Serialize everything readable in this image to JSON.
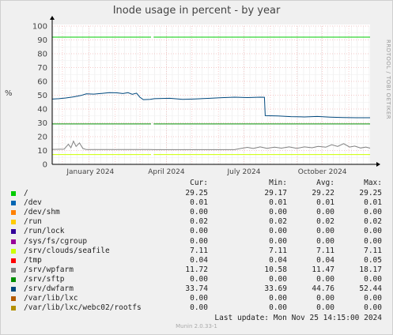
{
  "title": "Inode usage in percent - by year",
  "side_label": "RRDTOOL / TOBI OETIKER",
  "y_axis_label": "%",
  "columns": [
    "Cur:",
    "Min:",
    "Avg:",
    "Max:"
  ],
  "legend": [
    {
      "name": "/",
      "color": "#00cc00",
      "cur": "29.25",
      "min": "29.17",
      "avg": "29.22",
      "max": "29.25"
    },
    {
      "name": "/dev",
      "color": "#0066b3",
      "cur": "0.01",
      "min": "0.01",
      "avg": "0.01",
      "max": "0.01"
    },
    {
      "name": "/dev/shm",
      "color": "#ff8000",
      "cur": "0.00",
      "min": "0.00",
      "avg": "0.00",
      "max": "0.00"
    },
    {
      "name": "/run",
      "color": "#ffcc00",
      "cur": "0.02",
      "min": "0.02",
      "avg": "0.02",
      "max": "0.02"
    },
    {
      "name": "/run/lock",
      "color": "#330099",
      "cur": "0.00",
      "min": "0.00",
      "avg": "0.00",
      "max": "0.00"
    },
    {
      "name": "/sys/fs/cgroup",
      "color": "#990099",
      "cur": "0.00",
      "min": "0.00",
      "avg": "0.00",
      "max": "0.00"
    },
    {
      "name": "/srv/clouds/seafile",
      "color": "#ccff00",
      "cur": "7.11",
      "min": "7.11",
      "avg": "7.11",
      "max": "7.11"
    },
    {
      "name": "/tmp",
      "color": "#ff0000",
      "cur": "0.04",
      "min": "0.04",
      "avg": "0.04",
      "max": "0.05"
    },
    {
      "name": "/srv/wpfarm",
      "color": "#808080",
      "cur": "11.72",
      "min": "10.58",
      "avg": "11.47",
      "max": "18.17"
    },
    {
      "name": "/srv/sftp",
      "color": "#008f00",
      "cur": "0.00",
      "min": "0.00",
      "avg": "0.00",
      "max": "0.00"
    },
    {
      "name": "/srv/dwfarm",
      "color": "#00487d",
      "cur": "33.74",
      "min": "33.69",
      "avg": "44.76",
      "max": "52.44"
    },
    {
      "name": "/var/lib/lxc",
      "color": "#b35a00",
      "cur": "0.00",
      "min": "0.00",
      "avg": "0.00",
      "max": "0.00"
    },
    {
      "name": "/var/lib/lxc/webc02/rootfs",
      "color": "#b38f00",
      "cur": "0.00",
      "min": "0.00",
      "avg": "0.00",
      "max": "0.00"
    }
  ],
  "last_update": "Last update:  Mon Nov 25 14:15:00 2024",
  "munin_version": "Munin 2.0.33-1",
  "chart_data": {
    "type": "line",
    "ylim": [
      0,
      100
    ],
    "y_ticks": [
      "0",
      "10",
      "20",
      "30",
      "40",
      "50",
      "60",
      "70",
      "80",
      "90",
      "100"
    ],
    "x_range": [
      "2023-11-19",
      "2024-11-26"
    ],
    "x_ticks": [
      {
        "label": "January 2024",
        "date": "2024-01-01"
      },
      {
        "label": "April 2024",
        "date": "2024-04-01"
      },
      {
        "label": "July 2024",
        "date": "2024-07-01"
      },
      {
        "label": "October 2024",
        "date": "2024-10-01"
      }
    ],
    "gap": [
      "2024-03-14",
      "2024-03-17"
    ],
    "series": [
      {
        "name": "/",
        "color": "#00cc00",
        "points": [
          [
            "2023-11-19",
            92.0
          ],
          [
            "2024-11-26",
            92.0
          ]
        ]
      },
      {
        "name": "/srv/clouds/seafile",
        "color": "#ccff00",
        "points": [
          [
            "2023-11-19",
            7.11
          ],
          [
            "2024-11-26",
            7.11
          ]
        ]
      },
      {
        "name": "/srv/sftp",
        "color": "#008f00",
        "points": [
          [
            "2023-11-19",
            29.2
          ],
          [
            "2024-11-26",
            29.2
          ]
        ]
      },
      {
        "name": "/srv/wpfarm",
        "color": "#808080",
        "points": [
          [
            "2023-11-19",
            10.8
          ],
          [
            "2023-12-03",
            11.0
          ],
          [
            "2023-12-08",
            14.5
          ],
          [
            "2023-12-11",
            12.0
          ],
          [
            "2023-12-14",
            16.8
          ],
          [
            "2023-12-17",
            13.0
          ],
          [
            "2023-12-21",
            15.5
          ],
          [
            "2023-12-25",
            11.5
          ],
          [
            "2023-12-29",
            10.7
          ],
          [
            "2024-02-10",
            10.7
          ],
          [
            "2024-03-13",
            10.7
          ],
          [
            "2024-03-18",
            10.6
          ],
          [
            "2024-05-15",
            10.6
          ],
          [
            "2024-06-20",
            10.6
          ],
          [
            "2024-06-28",
            11.6
          ],
          [
            "2024-07-05",
            12.3
          ],
          [
            "2024-07-12",
            11.5
          ],
          [
            "2024-07-20",
            12.6
          ],
          [
            "2024-07-28",
            11.6
          ],
          [
            "2024-08-06",
            12.4
          ],
          [
            "2024-08-14",
            11.7
          ],
          [
            "2024-08-23",
            12.6
          ],
          [
            "2024-09-01",
            11.6
          ],
          [
            "2024-09-10",
            12.6
          ],
          [
            "2024-09-19",
            12.0
          ],
          [
            "2024-09-26",
            13.0
          ],
          [
            "2024-10-05",
            12.4
          ],
          [
            "2024-10-12",
            14.2
          ],
          [
            "2024-10-19",
            13.0
          ],
          [
            "2024-10-26",
            15.0
          ],
          [
            "2024-11-02",
            12.5
          ],
          [
            "2024-11-08",
            13.2
          ],
          [
            "2024-11-15",
            11.8
          ],
          [
            "2024-11-21",
            12.5
          ],
          [
            "2024-11-26",
            11.7
          ]
        ]
      },
      {
        "name": "/srv/dwfarm",
        "color": "#00487d",
        "points": [
          [
            "2023-11-19",
            47.2
          ],
          [
            "2023-11-27",
            47.5
          ],
          [
            "2023-12-05",
            48.0
          ],
          [
            "2023-12-14",
            48.8
          ],
          [
            "2023-12-23",
            49.8
          ],
          [
            "2023-12-29",
            51.0
          ],
          [
            "2024-01-07",
            50.8
          ],
          [
            "2024-01-16",
            51.3
          ],
          [
            "2024-01-25",
            51.8
          ],
          [
            "2024-02-03",
            51.7
          ],
          [
            "2024-02-10",
            51.2
          ],
          [
            "2024-02-16",
            51.8
          ],
          [
            "2024-02-21",
            50.7
          ],
          [
            "2024-02-26",
            51.5
          ],
          [
            "2024-03-01",
            48.5
          ],
          [
            "2024-03-05",
            46.8
          ],
          [
            "2024-03-13",
            47.0
          ],
          [
            "2024-03-18",
            47.5
          ],
          [
            "2024-04-05",
            47.8
          ],
          [
            "2024-04-20",
            47.0
          ],
          [
            "2024-05-05",
            47.3
          ],
          [
            "2024-05-20",
            47.7
          ],
          [
            "2024-06-05",
            48.2
          ],
          [
            "2024-06-20",
            48.6
          ],
          [
            "2024-07-05",
            48.3
          ],
          [
            "2024-07-20",
            48.6
          ],
          [
            "2024-07-25",
            48.5
          ],
          [
            "2024-07-26",
            35.2
          ],
          [
            "2024-08-10",
            35.0
          ],
          [
            "2024-08-25",
            34.5
          ],
          [
            "2024-09-10",
            34.3
          ],
          [
            "2024-09-25",
            34.6
          ],
          [
            "2024-10-10",
            34.2
          ],
          [
            "2024-10-25",
            33.9
          ],
          [
            "2024-11-10",
            33.7
          ],
          [
            "2024-11-26",
            33.7
          ]
        ]
      }
    ]
  }
}
